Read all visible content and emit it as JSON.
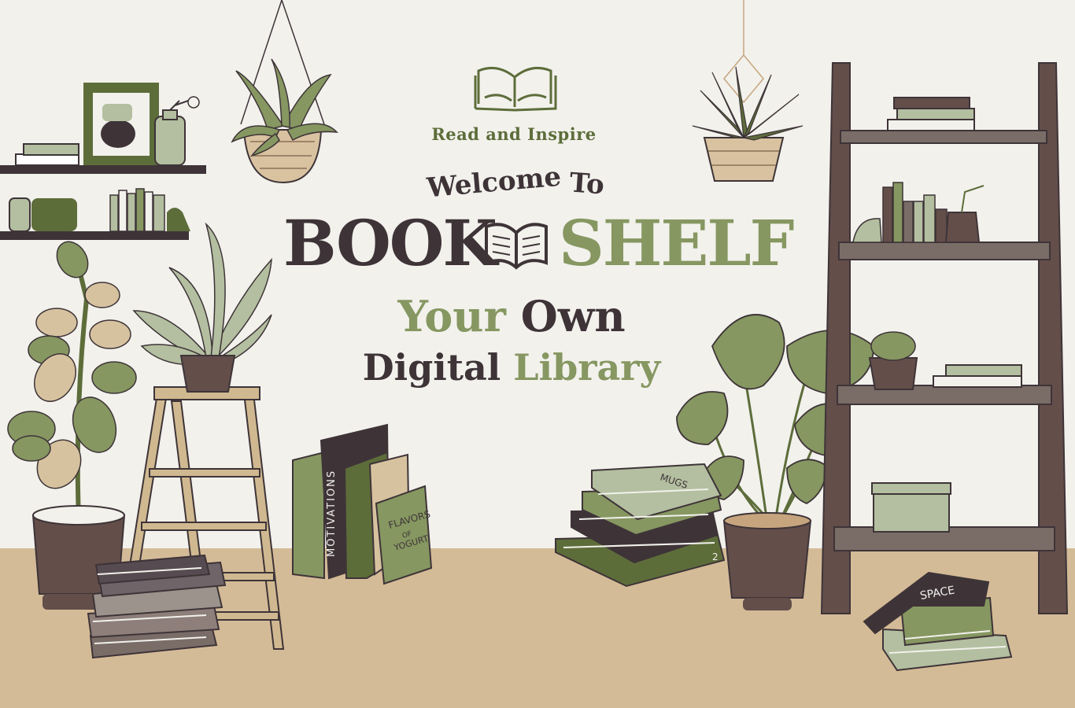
{
  "banner": {
    "tagline": "Read and Inspire",
    "welcome_word1": "Welcome",
    "welcome_word2": "To",
    "title_part1": "BOOK",
    "title_part2": "SHELF",
    "subtitle_word1": "Your",
    "subtitle_word2": "Own",
    "subtitle_word3": "Digital",
    "subtitle_word4": "Library"
  },
  "book_spines": {
    "motivations": "MOTIVATIONS",
    "flavors_line1": "FLAVORS",
    "flavors_line2": "OF",
    "flavors_line3": "YOGURT",
    "mugs": "MUGS",
    "space": "SPACE",
    "volume_number": "2"
  },
  "colors": {
    "background": "#f2f1ec",
    "floor": "#d4bb97",
    "olive": "#869761",
    "dark_olive": "#5d6d3a",
    "plum_brown": "#3e3438",
    "pot_brown": "#634e4a",
    "sage": "#b3bfa0",
    "tan_ladder": "#d0b990"
  }
}
